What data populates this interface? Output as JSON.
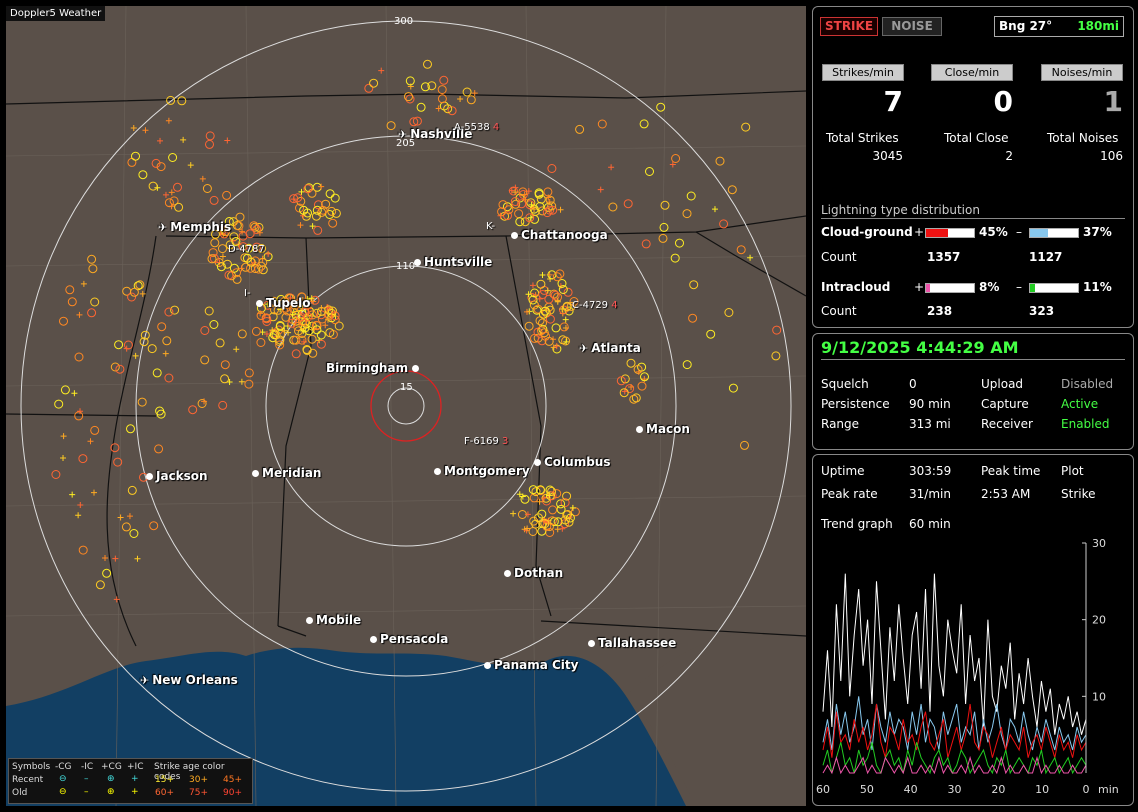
{
  "app_title": "Doppler5 Weather",
  "rings": [
    "300",
    "205",
    "110",
    "15"
  ],
  "cities": {
    "nashville": "Nashville",
    "memphis": "Memphis",
    "chattanooga": "Chattanooga",
    "huntsville": "Huntsville",
    "tupelo": "Tupelo",
    "atlanta": "Atlanta",
    "birmingham": "Birmingham",
    "macon": "Macon",
    "jackson": "Jackson",
    "meridian": "Meridian",
    "montgomery": "Montgomery",
    "columbus": "Columbus",
    "dothan": "Dothan",
    "mobile": "Mobile",
    "pensacola": "Pensacola",
    "tallahassee": "Tallahassee",
    "panama_city": "Panama City",
    "new_orleans": "New Orleans"
  },
  "storm_labels": {
    "a": "A-5538",
    "a_n": "4",
    "k": "K-",
    "c": "C-4729",
    "c_n": "4",
    "f": "F-6169",
    "f_n": "3",
    "i": "I-",
    "d": "D-4787"
  },
  "legend": {
    "symbols": "Symbols",
    "neg_cg": "-CG",
    "neg_ic": "-IC",
    "pos_cg": "+CG",
    "pos_ic": "+IC",
    "codes": "Strike age color codes",
    "recent": "Recent",
    "old": "Old",
    "r1": "15+",
    "r2": "30+",
    "r3": "45+",
    "o1": "60+",
    "o2": "75+",
    "o3": "90+"
  },
  "status": {
    "strike": "STRIKE",
    "noise": "NOISE",
    "bearing": "Bng 27°",
    "distance": "180mi",
    "strikes_min_label": "Strikes/min",
    "close_min_label": "Close/min",
    "noises_min_label": "Noises/min",
    "strikes_min": "7",
    "close_min": "0",
    "noises_min": "1",
    "total_strikes_label": "Total Strikes",
    "total_close_label": "Total Close",
    "total_noises_label": "Total Noises",
    "total_strikes": "3045",
    "total_close": "2",
    "total_noises": "106"
  },
  "distribution": {
    "title": "Lightning type distribution",
    "cg_label": "Cloud-ground",
    "ic_label": "Intracloud",
    "count_label": "Count",
    "plus": "+",
    "minus": "–",
    "cg_pos_pct": "45%",
    "cg_pos_frac": 0.45,
    "cg_pos_count": "1357",
    "cg_neg_pct": "37%",
    "cg_neg_frac": 0.37,
    "cg_neg_count": "1127",
    "ic_pos_pct": "8%",
    "ic_pos_frac": 0.08,
    "ic_pos_count": "238",
    "ic_neg_pct": "11%",
    "ic_neg_frac": 0.11,
    "ic_neg_count": "323",
    "colors": {
      "cg_pos": "#ee1111",
      "cg_neg": "#88c8ee",
      "ic_pos": "#ee55aa",
      "ic_neg": "#22cc22"
    }
  },
  "settings": {
    "datetime": "9/12/2025 4:44:29 AM",
    "squelch_label": "Squelch",
    "squelch": "0",
    "persistence_label": "Persistence",
    "persistence": "90 min",
    "range_label": "Range",
    "range": "313 mi",
    "upload_label": "Upload",
    "upload": "Disabled",
    "capture_label": "Capture",
    "capture": "Active",
    "receiver_label": "Receiver",
    "receiver": "Enabled"
  },
  "trend": {
    "uptime_label": "Uptime",
    "uptime": "303:59",
    "peak_time_label": "Peak time",
    "peak_time": "2:53 AM",
    "plot_label": "Plot",
    "plot": "Strike",
    "peak_rate_label": "Peak rate",
    "peak_rate": "31/min",
    "trend_label": "Trend graph",
    "trend_span": "60 min"
  },
  "chart_data": {
    "type": "line",
    "x_unit": "min",
    "x_ticks": [
      "60",
      "50",
      "40",
      "30",
      "20",
      "10",
      "0"
    ],
    "y_ticks": [
      "30",
      "20",
      "10"
    ],
    "ylim": [
      0,
      30
    ],
    "xlim": [
      60,
      0
    ],
    "series": [
      {
        "color": "#ffffff",
        "values": [
          8,
          16,
          6,
          22,
          12,
          26,
          10,
          18,
          24,
          14,
          20,
          9,
          25,
          16,
          7,
          19,
          12,
          22,
          15,
          9,
          18,
          21,
          11,
          24,
          8,
          26,
          14,
          10,
          20,
          16,
          13,
          22,
          9,
          18,
          12,
          15,
          6,
          20,
          10,
          8,
          14,
          11,
          17,
          7,
          13,
          9,
          15,
          10,
          6,
          12,
          8,
          11,
          5,
          9,
          7,
          10,
          6,
          8,
          5,
          7
        ]
      },
      {
        "color": "#88c8ee",
        "values": [
          4,
          7,
          3,
          9,
          5,
          8,
          4,
          6,
          10,
          5,
          7,
          3,
          9,
          6,
          4,
          8,
          5,
          7,
          6,
          3,
          8,
          5,
          9,
          4,
          7,
          6,
          3,
          8,
          5,
          7,
          9,
          4,
          6,
          5,
          8,
          3,
          7,
          4,
          6,
          9,
          5,
          3,
          7,
          6,
          4,
          8,
          5,
          3,
          6,
          4,
          7,
          5,
          3,
          6,
          4,
          5,
          3,
          6,
          4,
          5
        ]
      },
      {
        "color": "#ee1111",
        "values": [
          3,
          6,
          2,
          8,
          4,
          5,
          3,
          7,
          4,
          6,
          3,
          5,
          9,
          4,
          2,
          6,
          5,
          3,
          7,
          4,
          5,
          3,
          6,
          8,
          4,
          3,
          5,
          7,
          2,
          4,
          6,
          3,
          5,
          9,
          4,
          3,
          6,
          5,
          2,
          4,
          6,
          3,
          5,
          4,
          3,
          6,
          2,
          4,
          5,
          3,
          6,
          4,
          2,
          5,
          3,
          4,
          2,
          5,
          3,
          4
        ]
      },
      {
        "color": "#22cc22",
        "values": [
          1,
          3,
          0,
          2,
          4,
          1,
          2,
          0,
          3,
          1,
          2,
          4,
          1,
          0,
          2,
          3,
          1,
          2,
          0,
          3,
          1,
          4,
          2,
          1,
          0,
          2,
          3,
          1,
          2,
          0,
          1,
          3,
          2,
          0,
          1,
          2,
          3,
          1,
          0,
          2,
          1,
          3,
          0,
          1,
          2,
          1,
          0,
          2,
          1,
          3,
          0,
          1,
          2,
          0,
          1,
          2,
          0,
          1,
          2,
          1
        ]
      },
      {
        "color": "#ee55aa",
        "values": [
          0,
          1,
          0,
          2,
          0,
          1,
          0,
          0,
          1,
          2,
          0,
          1,
          0,
          0,
          2,
          1,
          0,
          1,
          0,
          2,
          0,
          0,
          1,
          0,
          1,
          0,
          2,
          0,
          1,
          0,
          0,
          1,
          0,
          2,
          0,
          1,
          0,
          0,
          1,
          0,
          2,
          0,
          1,
          0,
          0,
          1,
          0,
          0,
          2,
          0,
          1,
          0,
          0,
          1,
          0,
          0,
          1,
          0,
          0,
          1
        ]
      }
    ]
  }
}
